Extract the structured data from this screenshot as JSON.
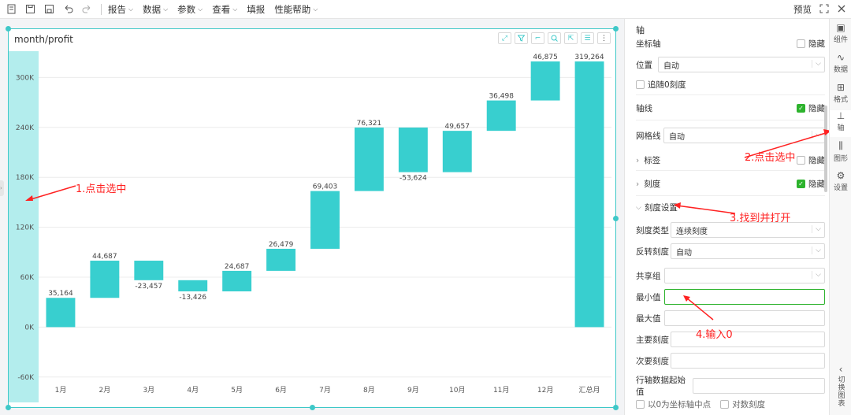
{
  "toolbar": {
    "menus": [
      "报告",
      "数据",
      "参数",
      "查看",
      "填报",
      "性能帮助"
    ],
    "preview": "预览"
  },
  "chart": {
    "title": "month/profit"
  },
  "chart_data": {
    "type": "bar",
    "subtype": "waterfall",
    "categories": [
      "1月",
      "2月",
      "3月",
      "4月",
      "5月",
      "6月",
      "7月",
      "8月",
      "9月",
      "10月",
      "11月",
      "12月",
      "汇总月"
    ],
    "values": [
      35164,
      44687,
      -23457,
      -13426,
      24687,
      26479,
      69403,
      76321,
      -53624,
      49657,
      36498,
      46875,
      319264
    ],
    "labels": [
      "35,164",
      "44,687",
      "-23,457",
      "-13,426",
      "24,687",
      "26,479",
      "69,403",
      "76,321",
      "-53,624",
      "49,657",
      "36,498",
      "46,875",
      "319,264"
    ],
    "y_ticks": [
      "300K",
      "240K",
      "180K",
      "120K",
      "60K",
      "0K",
      "-60K"
    ],
    "y_tick_values": [
      300000,
      240000,
      180000,
      120000,
      60000,
      0,
      -60000
    ],
    "ylim": [
      -60000,
      300000
    ],
    "grid": true,
    "color": "#38cfcf"
  },
  "annotations": {
    "a1": "1.点击选中",
    "a2": "2.点击选中",
    "a3": "3.找到并打开",
    "a4": "4.输入0"
  },
  "panel": {
    "header": "轴",
    "coord_axis": "坐标轴",
    "hide": "隐藏",
    "position_label": "位置",
    "position_value": "自动",
    "follow_zero": "追随0刻度",
    "axis_line": "轴线",
    "gridline_label": "网格线",
    "gridline_value": "自动",
    "label_section": "标签",
    "tick_section": "刻度",
    "tick_settings": "刻度设置",
    "tick_type_label": "刻度类型",
    "tick_type_value": "连续刻度",
    "reverse_label": "反转刻度",
    "reverse_value": "自动",
    "share_group_label": "共享组",
    "min_label": "最小值",
    "max_label": "最大值",
    "major_label": "主要刻度",
    "minor_label": "次要刻度",
    "row_start_label": "行轴数据起始值",
    "zero_center": "以0为坐标轴中点",
    "log_scale": "对数刻度"
  },
  "rail": {
    "items": [
      "组件",
      "数据",
      "格式",
      "轴",
      "图形",
      "设置"
    ],
    "switch_chart": "切换图表"
  }
}
